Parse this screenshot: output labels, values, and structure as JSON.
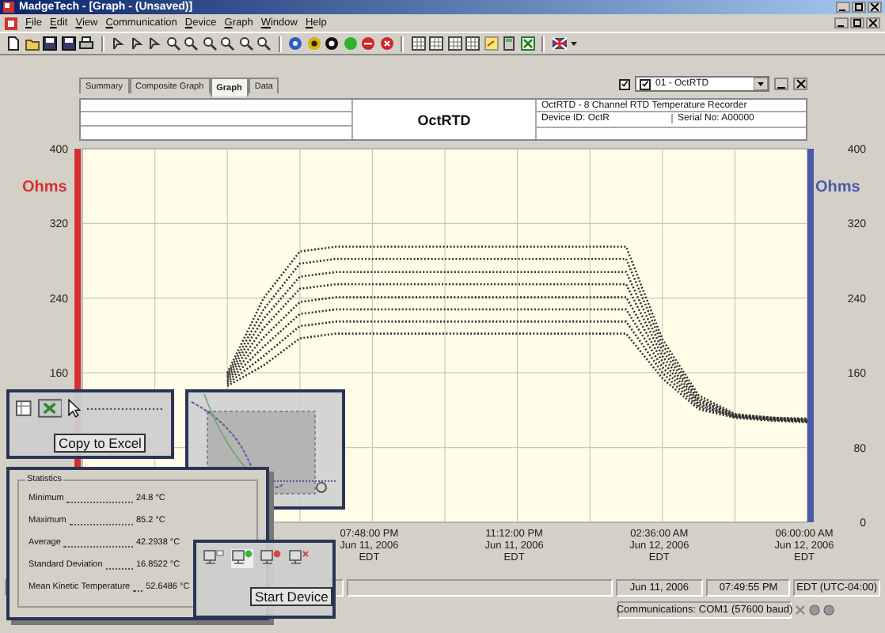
{
  "window": {
    "title": "MadgeTech - [Graph - (Unsaved)]"
  },
  "menu": [
    "File",
    "Edit",
    "View",
    "Communication",
    "Device",
    "Graph",
    "Window",
    "Help"
  ],
  "tabs": [
    {
      "label": "Summary",
      "selected": false
    },
    {
      "label": "Composite Graph",
      "selected": false
    },
    {
      "label": "Graph",
      "selected": true
    },
    {
      "label": "Data",
      "selected": false
    }
  ],
  "channel_selector": {
    "visible": true,
    "checked": true,
    "value": "01 - OctRTD"
  },
  "header": {
    "title": "OctRTD",
    "description": "OctRTD - 8 Channel RTD Temperature Recorder",
    "device_id": "Device ID: OctR",
    "serial": "Serial No: A00000"
  },
  "chart": {
    "left_axis_label": "Ohms",
    "right_axis_label": "Ohms",
    "right_ticks": [
      "400",
      "320",
      "240",
      "160",
      "80",
      "0"
    ],
    "chart_data": {
      "type": "line",
      "grid": true,
      "categories": [
        null,
        null,
        null,
        null,
        null,
        null,
        null,
        null,
        "07:48:00 PM\nJun 11, 2006\nEDT",
        null,
        null,
        null,
        "11:12:00 PM\nJun 11, 2006\nEDT",
        null,
        null,
        null,
        "02:36:00 AM\nJun 12, 2006\nEDT",
        null,
        null,
        null,
        "06:00:00 AM\nJun 12, 2006\nEDT"
      ],
      "ylim": [
        0,
        400
      ],
      "yticks": [
        160,
        240,
        320,
        400
      ],
      "series": [
        {
          "color": "#333333",
          "line_style": "dotted",
          "values": [
            null,
            null,
            null,
            null,
            160,
            240,
            290,
            295,
            295,
            295,
            295,
            295,
            295,
            295,
            295,
            295,
            196,
            136,
            116,
            112,
            111
          ]
        },
        {
          "color": "#333333",
          "line_style": "dotted",
          "values": [
            null,
            null,
            null,
            null,
            158,
            228,
            277,
            282,
            282,
            282,
            282,
            282,
            282,
            282,
            282,
            282,
            190,
            133,
            115,
            112,
            110
          ]
        },
        {
          "color": "#333333",
          "line_style": "dotted",
          "values": [
            null,
            null,
            null,
            null,
            156,
            218,
            263,
            268,
            268,
            268,
            268,
            268,
            268,
            268,
            268,
            268,
            184,
            131,
            114,
            111,
            110
          ]
        },
        {
          "color": "#333333",
          "line_style": "dotted",
          "values": [
            null,
            null,
            null,
            null,
            154,
            208,
            250,
            255,
            255,
            255,
            255,
            255,
            255,
            255,
            255,
            255,
            178,
            129,
            114,
            111,
            109
          ]
        },
        {
          "color": "#333333",
          "line_style": "dotted",
          "values": [
            null,
            null,
            null,
            null,
            152,
            198,
            236,
            241,
            241,
            241,
            241,
            241,
            241,
            241,
            241,
            241,
            172,
            127,
            113,
            110,
            109
          ]
        },
        {
          "color": "#333333",
          "line_style": "dotted",
          "values": [
            null,
            null,
            null,
            null,
            150,
            188,
            223,
            228,
            228,
            228,
            228,
            228,
            228,
            228,
            228,
            228,
            166,
            125,
            113,
            110,
            108
          ]
        },
        {
          "color": "#333333",
          "line_style": "dotted",
          "values": [
            null,
            null,
            null,
            null,
            148,
            178,
            210,
            215,
            215,
            215,
            215,
            215,
            215,
            215,
            215,
            215,
            160,
            123,
            112,
            109,
            108
          ]
        },
        {
          "color": "#333333",
          "line_style": "dotted",
          "values": [
            null,
            null,
            null,
            null,
            146,
            168,
            197,
            202,
            202,
            202,
            202,
            202,
            202,
            202,
            202,
            202,
            154,
            121,
            112,
            109,
            107
          ]
        }
      ]
    }
  },
  "callouts": {
    "excel_tooltip": "Copy to Excel",
    "start_tooltip": "Start Device"
  },
  "statistics": {
    "title": "Statistics",
    "rows": [
      {
        "label": "Minimum",
        "value": "24.8 °C"
      },
      {
        "label": "Maximum",
        "value": "85.2 °C"
      },
      {
        "label": "Average",
        "value": "42.2938 °C"
      },
      {
        "label": "Standard Deviation",
        "value": "16.8522 °C"
      },
      {
        "label": "Mean Kinetic Temperature",
        "value": "52.6486 °C"
      }
    ]
  },
  "status_bar": {
    "date": "Jun 11, 2006",
    "time": "07:49:55 PM",
    "timezone": "EDT (UTC-04:00)",
    "communications": "Communications: COM1 (57600 baud)"
  }
}
